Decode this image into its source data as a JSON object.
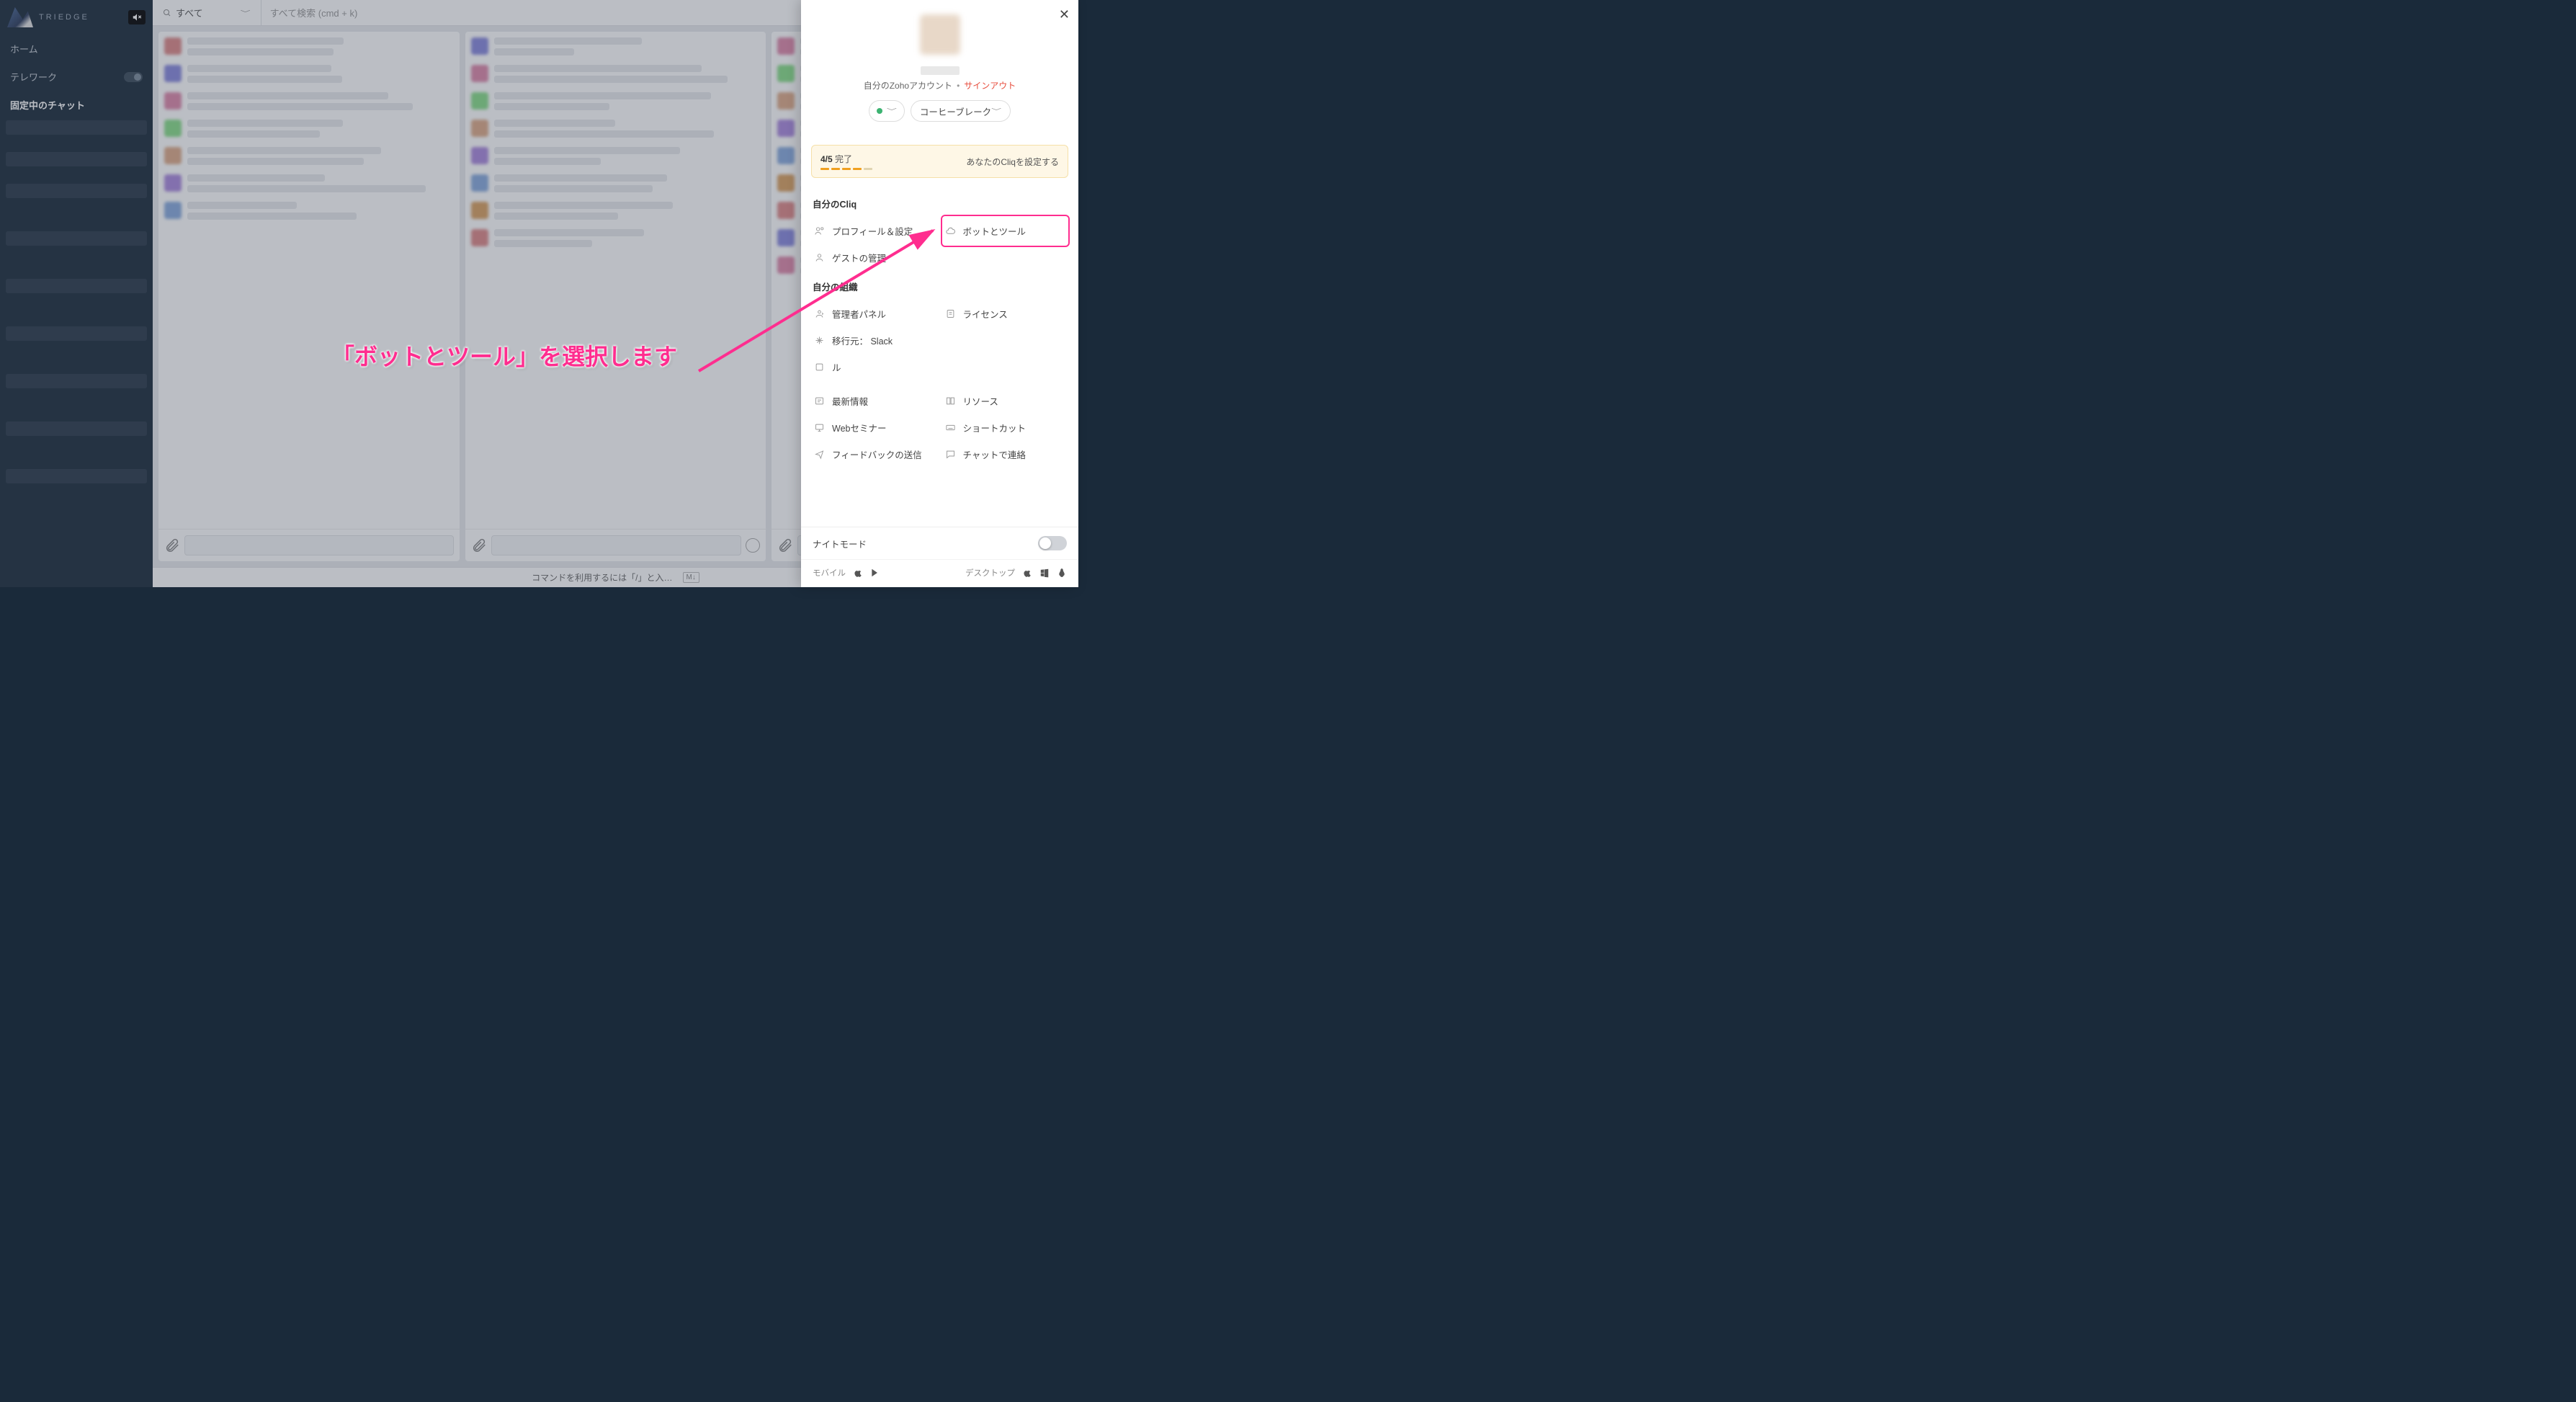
{
  "brand": "TRIEDGE",
  "nav": {
    "home": "ホーム",
    "telework": "テレワーク",
    "pinned": "固定中のチャット"
  },
  "topbar": {
    "filter": "すべて",
    "search_placeholder": "すべて検索 (cmd + k)"
  },
  "hint": {
    "cmd": "コマンドを利用するには「/」と入…",
    "md": "M↓"
  },
  "panel": {
    "account_label": "自分のZohoアカウント",
    "signout": "サインアウト",
    "status": "コーヒーブレーク",
    "progress": {
      "done": "4/5",
      "label": "完了",
      "cta": "あなたのCliqを設定する"
    },
    "section_cliq": "自分のCliq",
    "profile_settings": "プロフィール＆設定",
    "bots_tools": "ボットとツール",
    "guest_mgmt": "ゲストの管理",
    "section_org": "自分の組織",
    "admin_panel": "管理者パネル",
    "license": "ライセンス",
    "migrate": "移行元： Slack",
    "row_unknown": "ル",
    "whats_new": "最新情報",
    "resources": "リソース",
    "webinar": "Webセミナー",
    "shortcuts": "ショートカット",
    "feedback": "フィードバックの送信",
    "chat_contact": "チャットで連絡",
    "night_mode": "ナイトモード",
    "mobile": "モバイル",
    "desktop": "デスクトップ"
  },
  "annotation": "「ボットとツール」を選択します"
}
